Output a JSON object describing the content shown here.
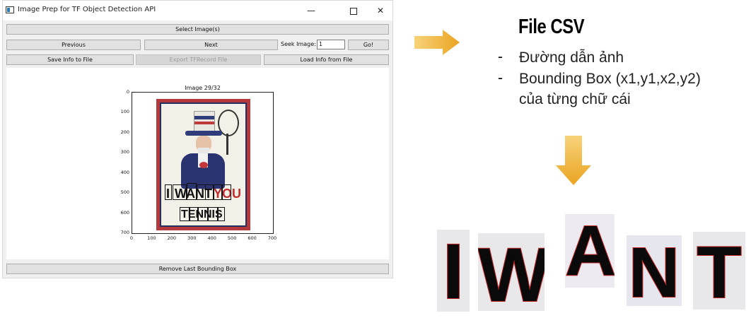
{
  "window": {
    "title": "Image Prep for TF Object Detection API",
    "minimize_glyph": "—",
    "close_glyph": "✕"
  },
  "toolbar": {
    "select_images": "Select Image(s)",
    "previous": "Previous",
    "next": "Next",
    "seek_label": "Seek Image:",
    "seek_value": "1",
    "go": "Go!",
    "save_info": "Save Info to File",
    "export_tfrecord": "Export TFRecord File",
    "load_info": "Load Info from File",
    "remove_last_box": "Remove Last Bounding Box"
  },
  "plot": {
    "title": "Image 29/32",
    "y_ticks": [
      "0",
      "100",
      "200",
      "300",
      "400",
      "500",
      "600",
      "700"
    ],
    "x_ticks": [
      "0",
      "100",
      "200",
      "300",
      "400",
      "500",
      "600",
      "700"
    ],
    "poster_words": [
      "I",
      "WANT",
      "YOU",
      "TENNIS"
    ]
  },
  "annotation": {
    "title": "File CSV",
    "bullets": [
      {
        "dash": "-",
        "lines": [
          "Đường dẫn ảnh"
        ]
      },
      {
        "dash": "-",
        "lines": [
          "Bounding Box (x1,y1,x2,y2)",
          "của từng chữ cái"
        ]
      }
    ],
    "arrow_color": "#f0b83c"
  },
  "crops": [
    "I",
    "W",
    "A",
    "N",
    "T"
  ]
}
